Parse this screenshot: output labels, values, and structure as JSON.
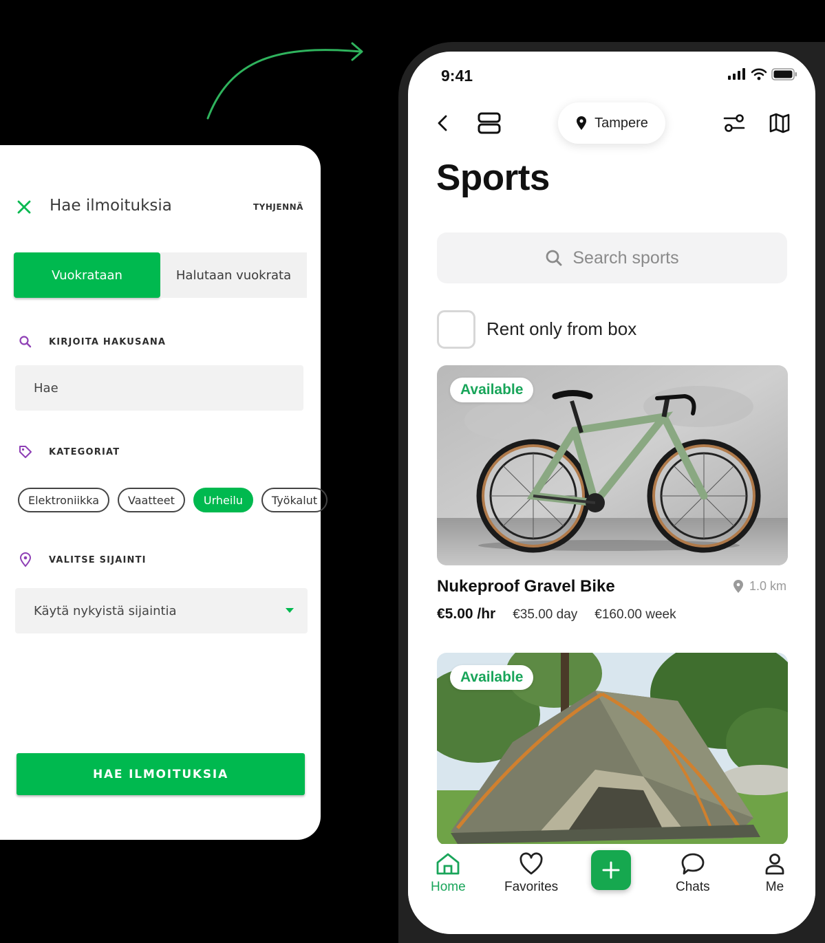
{
  "left_panel": {
    "title": "Hae ilmoituksia",
    "clear_label": "TYHJENNÄ",
    "segment": {
      "active": "Vuokrataan",
      "inactive": "Halutaan vuokrata"
    },
    "search_section_label": "KIRJOITA HAKUSANA",
    "search_placeholder": "Hae",
    "categories_label": "KATEGORIAT",
    "categories": [
      "Elektroniikka",
      "Vaatteet",
      "Urheilu",
      "Työkalut"
    ],
    "selected_category": "Urheilu",
    "location_label": "VALITSE SIJAINTI",
    "location_value": "Käytä nykyistä sijaintia",
    "submit_label": "HAE ILMOITUKSIA",
    "accent_color": "#00b94f"
  },
  "phone": {
    "time": "9:41",
    "location": "Tampere",
    "page_title": "Sports",
    "search_placeholder": "Search sports",
    "checkbox_label": "Rent only from box",
    "checkbox_checked": false,
    "listings": [
      {
        "badge": "Available",
        "title": "Nukeproof Gravel Bike",
        "distance": "1.0 km",
        "price_hour": "€5.00 /hr",
        "price_day": "€35.00 day",
        "price_week": "€160.00 week",
        "image": "gravel-bike-photo"
      },
      {
        "badge": "Available",
        "image": "tent-photo"
      }
    ],
    "tabs": [
      {
        "label": "Home",
        "icon": "home-icon",
        "active": true
      },
      {
        "label": "Favorites",
        "icon": "heart-icon",
        "active": false
      },
      {
        "label": "",
        "icon": "plus-icon",
        "active": false
      },
      {
        "label": "Chats",
        "icon": "chat-icon",
        "active": false
      },
      {
        "label": "Me",
        "icon": "user-icon",
        "active": false
      }
    ],
    "accent_color": "#19a55a"
  }
}
